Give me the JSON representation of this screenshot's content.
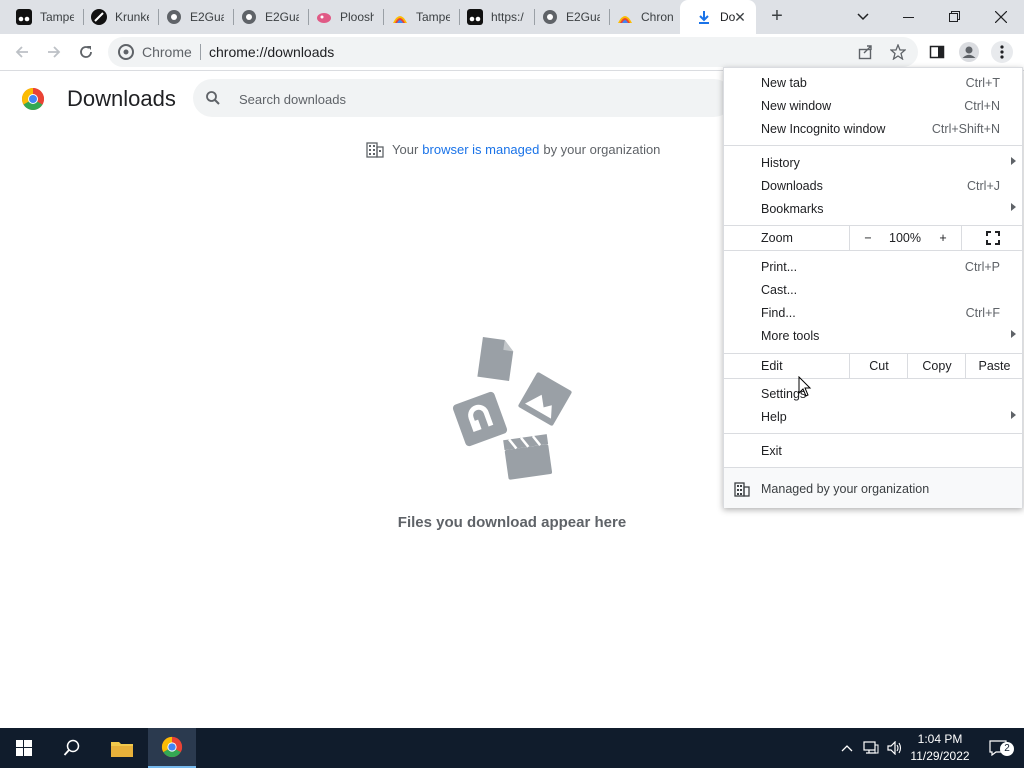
{
  "tabs": [
    {
      "title": "Tampe",
      "icon": "tampermonkey-icon"
    },
    {
      "title": "Krunke",
      "icon": "krunker-icon"
    },
    {
      "title": "E2Gua",
      "icon": "globe-icon"
    },
    {
      "title": "E2Gua",
      "icon": "globe-icon"
    },
    {
      "title": "Ploosh",
      "icon": "ploosh-icon"
    },
    {
      "title": "Tampe",
      "icon": "webstore-icon"
    },
    {
      "title": "https:/",
      "icon": "tampermonkey-icon"
    },
    {
      "title": "E2Gua",
      "icon": "globe-icon"
    },
    {
      "title": "Chron",
      "icon": "webstore-icon"
    },
    {
      "title": "Do",
      "icon": "download-icon",
      "active": true
    }
  ],
  "omnibox": {
    "site": "Chrome",
    "url": "chrome://downloads"
  },
  "page": {
    "title": "Downloads",
    "search_placeholder": "Search downloads",
    "managed_prefix": "Your",
    "managed_link": "browser is managed",
    "managed_suffix": "by your organization",
    "empty_message": "Files you download appear here"
  },
  "menu": {
    "items": [
      {
        "label": "New tab",
        "shortcut": "Ctrl+T"
      },
      {
        "label": "New window",
        "shortcut": "Ctrl+N"
      },
      {
        "label": "New Incognito window",
        "shortcut": "Ctrl+Shift+N"
      },
      {
        "label": "History",
        "shortcut": ""
      },
      {
        "label": "Downloads",
        "shortcut": "Ctrl+J"
      },
      {
        "label": "Bookmarks",
        "shortcut": ""
      },
      {
        "label": "Print...",
        "shortcut": "Ctrl+P"
      },
      {
        "label": "Cast...",
        "shortcut": ""
      },
      {
        "label": "Find...",
        "shortcut": "Ctrl+F"
      },
      {
        "label": "More tools",
        "shortcut": ""
      },
      {
        "label": "Settings",
        "shortcut": ""
      },
      {
        "label": "Help",
        "shortcut": ""
      },
      {
        "label": "Exit",
        "shortcut": ""
      }
    ],
    "zoom": {
      "label": "Zoom",
      "minus": "−",
      "value": "100%",
      "plus": "+"
    },
    "edit": {
      "label": "Edit",
      "cut": "Cut",
      "copy": "Copy",
      "paste": "Paste"
    },
    "managed": "Managed by your organization"
  },
  "taskbar": {
    "time": "1:04 PM",
    "date": "11/29/2022",
    "notifications": "2"
  },
  "colors": {
    "accent": "#1a73e8",
    "tabstrip": "#dee1e6",
    "taskbar": "#101c2c"
  }
}
